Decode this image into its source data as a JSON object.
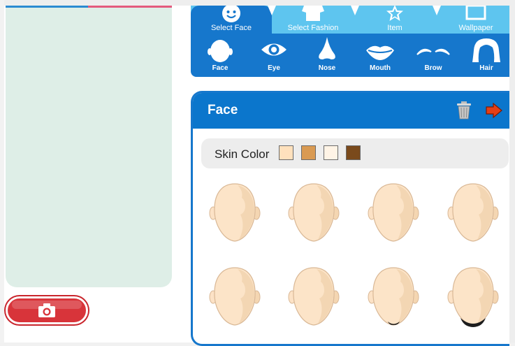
{
  "colors": {
    "primary_blue": "#1677cc",
    "light_blue": "#5ec5ef",
    "preview_bg": "#deeee7",
    "camera_red": "#d8343a",
    "arrow_orange": "#e53f16"
  },
  "tabs": [
    {
      "label": "Select Face",
      "icon": "smiley-icon",
      "active": true
    },
    {
      "label": "Select Fashion",
      "icon": "shirt-icon",
      "active": false
    },
    {
      "label": "Item",
      "icon": "star-icon",
      "active": false
    },
    {
      "label": "Wallpaper",
      "icon": "picture-frame-icon",
      "active": false
    }
  ],
  "features": [
    {
      "label": "Face",
      "icon": "face-outline-icon"
    },
    {
      "label": "Eye",
      "icon": "eye-icon"
    },
    {
      "label": "Nose",
      "icon": "nose-icon"
    },
    {
      "label": "Mouth",
      "icon": "mouth-icon"
    },
    {
      "label": "Brow",
      "icon": "brow-icon"
    },
    {
      "label": "Hair",
      "icon": "hair-icon"
    }
  ],
  "panel": {
    "title": "Face",
    "trash_icon": "trash-icon",
    "next_icon": "next-arrow-icon"
  },
  "skin": {
    "label": "Skin Color",
    "swatches": [
      "#ffe1bd",
      "#d99a52",
      "#fff4e6",
      "#7a4a1c"
    ]
  },
  "face_options": [
    {
      "beard": false
    },
    {
      "beard": false
    },
    {
      "beard": false
    },
    {
      "beard": false
    },
    {
      "beard": false
    },
    {
      "beard": false
    },
    {
      "beard": "small"
    },
    {
      "beard": "full"
    }
  ],
  "camera_button": {
    "icon": "camera-icon"
  }
}
